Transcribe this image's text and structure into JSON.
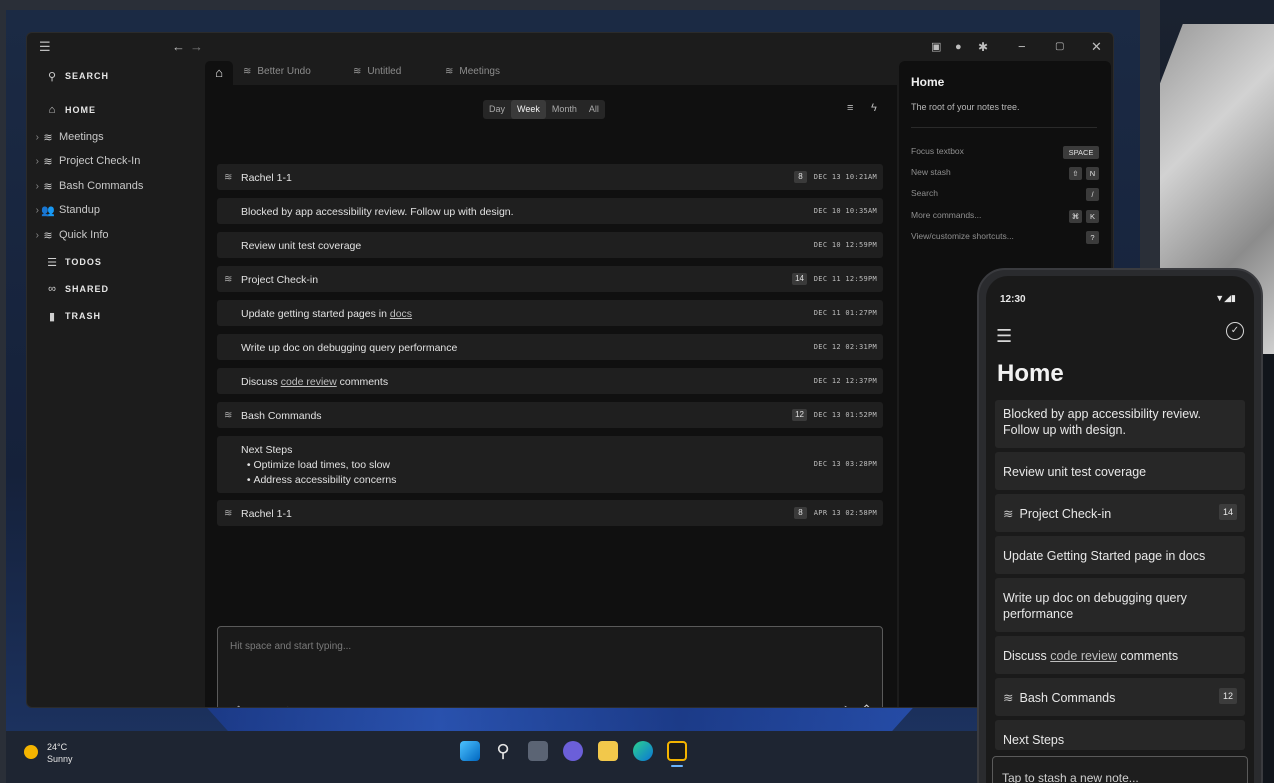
{
  "sidebar": {
    "search_label": "SEARCH",
    "home_label": "HOME",
    "items": [
      {
        "label": "Meetings"
      },
      {
        "label": "Project Check-In"
      },
      {
        "label": "Bash Commands"
      },
      {
        "label": "Standup"
      },
      {
        "label": "Quick Info"
      }
    ],
    "todos_label": "TODOS",
    "shared_label": "SHARED",
    "trash_label": "TRASH"
  },
  "tabs": [
    {
      "label": "Better Undo"
    },
    {
      "label": "Untitled"
    },
    {
      "label": "Meetings"
    }
  ],
  "range": {
    "options": [
      "Day",
      "Week",
      "Month",
      "All"
    ],
    "selected": "Week"
  },
  "rows": [
    {
      "label": "Rachel 1-1",
      "count": "8",
      "date": "DEC 13 10:21AM"
    },
    {
      "label": "Blocked by app accessibility review. Follow up with design.",
      "date": "DEC 10 10:35AM"
    },
    {
      "label": "Review unit test coverage",
      "date": "DEC 10 12:59PM"
    },
    {
      "label": "Project Check-in",
      "count": "14",
      "date": "DEC 11 12:59PM"
    },
    {
      "label_pre": "Update getting started pages in ",
      "link": "docs",
      "date": "DEC 11 01:27PM"
    },
    {
      "label": "Write up doc on debugging query performance",
      "date": "DEC 12 02:31PM"
    },
    {
      "label_pre": "Discuss ",
      "link": "code review",
      "label_post": " comments",
      "date": "DEC 12 12:37PM"
    },
    {
      "label": "Bash Commands",
      "count": "12",
      "date": "DEC 13 01:52PM"
    },
    {
      "title": "Next Steps",
      "bullets": [
        "Optimize load times, too slow",
        "Address accessibility concerns"
      ],
      "date": "DEC 13 03:28PM"
    },
    {
      "label": "Rachel 1-1",
      "count": "8",
      "date": "APR 13 02:58PM"
    }
  ],
  "composer": {
    "placeholder": "Hit space and start typing..."
  },
  "panel": {
    "title": "Home",
    "description": "The root of your notes tree.",
    "shortcuts": [
      {
        "label": "Focus textbox",
        "keys": [
          "SPACE"
        ]
      },
      {
        "label": "New stash",
        "keys": [
          "⇧",
          "N"
        ]
      },
      {
        "label": "Search",
        "keys": [
          "/"
        ]
      },
      {
        "label": "More commands...",
        "keys": [
          "⌘",
          "K"
        ]
      },
      {
        "label": "View/customize shortcuts...",
        "keys": [
          "?"
        ]
      }
    ]
  },
  "taskbar": {
    "temperature": "24°C",
    "condition": "Sunny"
  },
  "phone": {
    "time": "12:30",
    "title": "Home",
    "cards": [
      {
        "label": "Blocked by app accessibility review. Follow up with design."
      },
      {
        "label": "Review unit test coverage"
      },
      {
        "label": "Project Check-in",
        "count": "14"
      },
      {
        "label": "Update Getting Started page in docs"
      },
      {
        "label": "Write up doc on debugging query performance"
      },
      {
        "label_pre": "Discuss ",
        "link": "code review",
        "label_post": " comments"
      },
      {
        "label": "Bash Commands",
        "count": "12"
      },
      {
        "label": "Next Steps"
      }
    ],
    "input_placeholder": "Tap to stash a new note..."
  },
  "colors": {
    "accent": "#f4b400",
    "surface": "#1f1f1f",
    "background": "#101010"
  }
}
